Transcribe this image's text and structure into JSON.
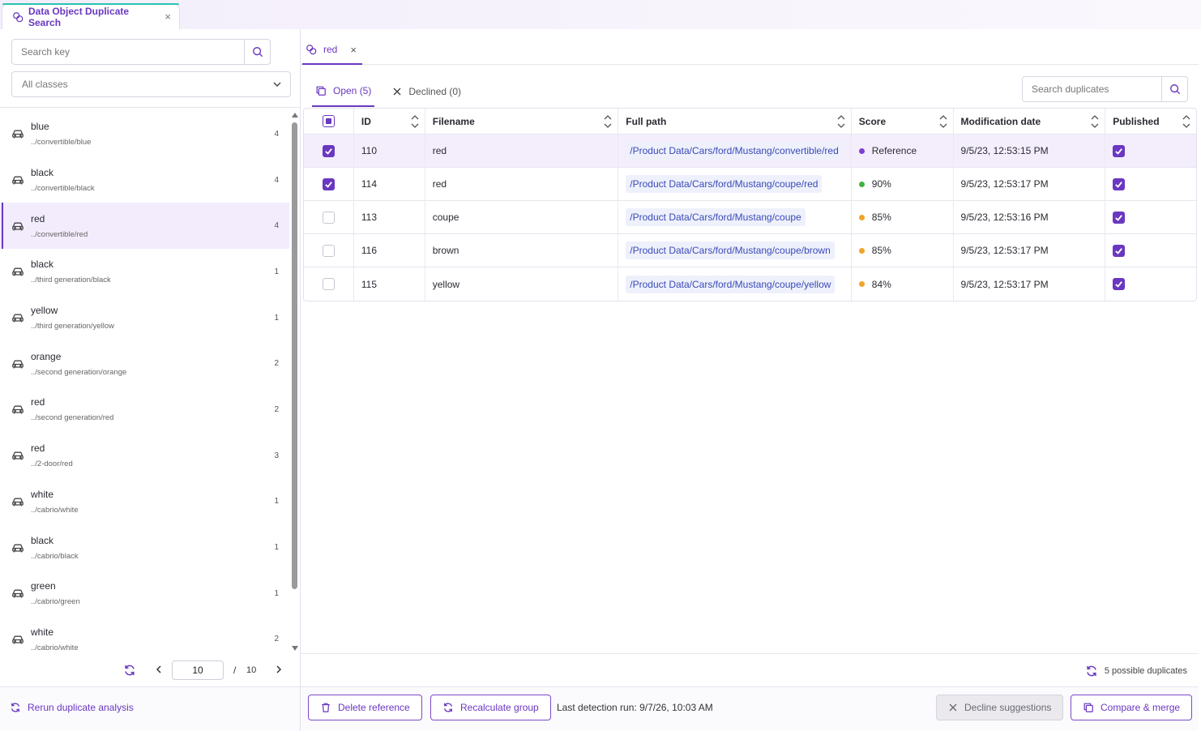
{
  "top_tab": {
    "label": "Data Object Duplicate Search",
    "close": "×"
  },
  "sidebar": {
    "search_placeholder": "Search key",
    "class_filter": "All classes",
    "items": [
      {
        "name": "blue",
        "path": "../convertible/blue",
        "count": "4"
      },
      {
        "name": "black",
        "path": "../convertible/black",
        "count": "4"
      },
      {
        "name": "red",
        "path": "../convertible/red",
        "count": "4"
      },
      {
        "name": "black",
        "path": "../third generation/black",
        "count": "1"
      },
      {
        "name": "yellow",
        "path": "../third generation/yellow",
        "count": "1"
      },
      {
        "name": "orange",
        "path": "../second generation/orange",
        "count": "2"
      },
      {
        "name": "red",
        "path": "../second generation/red",
        "count": "2"
      },
      {
        "name": "red",
        "path": "../2-door/red",
        "count": "3"
      },
      {
        "name": "white",
        "path": "../cabrio/white",
        "count": "1"
      },
      {
        "name": "black",
        "path": "../cabrio/black",
        "count": "1"
      },
      {
        "name": "green",
        "path": "../cabrio/green",
        "count": "1"
      },
      {
        "name": "white",
        "path": "../cabrio/white",
        "count": "2"
      }
    ],
    "active_index": 2,
    "pager": {
      "current": "10",
      "separator": "/",
      "total": "10"
    },
    "rerun_label": "Rerun duplicate analysis"
  },
  "detail": {
    "tab_label": "red",
    "tab_close": "×",
    "subtabs": [
      {
        "label": "Open (5)",
        "icon": "copy-icon",
        "active": true
      },
      {
        "label": "Declined (0)",
        "icon": "close-icon",
        "active": false
      }
    ],
    "search_placeholder": "Search duplicates",
    "columns": [
      "ID",
      "Filename",
      "Full path",
      "Score",
      "Modification date",
      "Published"
    ],
    "rows": [
      {
        "checked": true,
        "id": "110",
        "filename": "red",
        "path": "/Product Data/Cars/ford/Mustang/convertible/red",
        "score": "Reference",
        "score_color": "#7b3fd0",
        "date": "9/5/23, 12:53:15 PM",
        "published": true
      },
      {
        "checked": true,
        "id": "114",
        "filename": "red",
        "path": "/Product Data/Cars/ford/Mustang/coupe/red",
        "score": "90%",
        "score_color": "#3fb43f",
        "date": "9/5/23, 12:53:17 PM",
        "published": true
      },
      {
        "checked": false,
        "id": "113",
        "filename": "coupe",
        "path": "/Product Data/Cars/ford/Mustang/coupe",
        "score": "85%",
        "score_color": "#f0a429",
        "date": "9/5/23, 12:53:16 PM",
        "published": true
      },
      {
        "checked": false,
        "id": "116",
        "filename": "brown",
        "path": "/Product Data/Cars/ford/Mustang/coupe/brown",
        "score": "85%",
        "score_color": "#f0a429",
        "date": "9/5/23, 12:53:17 PM",
        "published": true
      },
      {
        "checked": false,
        "id": "115",
        "filename": "yellow",
        "path": "/Product Data/Cars/ford/Mustang/coupe/yellow",
        "score": "84%",
        "score_color": "#f0a429",
        "date": "9/5/23, 12:53:17 PM",
        "published": true
      }
    ],
    "possible_duplicates": "5 possible duplicates",
    "footer": {
      "delete_reference": "Delete reference",
      "recalculate_group": "Recalculate group",
      "last_run": "Last detection run: 9/7/26, 10:03 AM",
      "decline_suggestions": "Decline suggestions",
      "compare_merge": "Compare & merge"
    }
  },
  "colors": {
    "accent": "#6a38c0",
    "path_text": "#3b49b8",
    "path_bg": "#eef1fb",
    "selected_row": "#f4eefc"
  }
}
